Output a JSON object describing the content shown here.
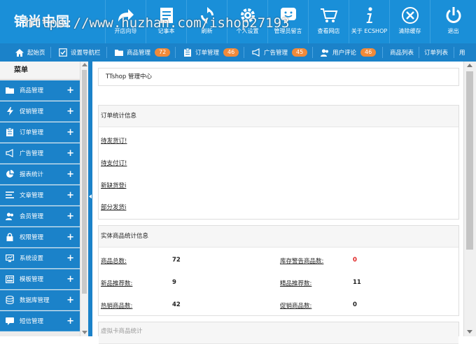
{
  "header": {
    "logo": "锦尚中国",
    "watermark": "https://www.huzhan.com/ishop27193",
    "buttons": [
      {
        "icon": "share-arrow-icon",
        "label": "开店向导"
      },
      {
        "icon": "notepad-icon",
        "label": "记事本"
      },
      {
        "icon": "refresh-icon",
        "label": "刷新"
      },
      {
        "icon": "gear-icon",
        "label": "个人设置"
      },
      {
        "icon": "chat-smile-icon",
        "label": "管理员留言"
      },
      {
        "icon": "cart-icon",
        "label": "查看网店"
      },
      {
        "icon": "info-icon",
        "label": "关于 ECSHOP"
      },
      {
        "icon": "close-circle-icon",
        "label": "清除缓存"
      },
      {
        "icon": "power-icon",
        "label": "退出"
      }
    ]
  },
  "nav": {
    "items": [
      {
        "icon": "home-icon",
        "label": "起始页"
      },
      {
        "icon": "check-box-icon",
        "label": "设置导航栏"
      },
      {
        "icon": "folder-icon",
        "label": "商品管理",
        "badge": "72"
      },
      {
        "icon": "clipboard-icon",
        "label": "订单管理",
        "badge": "46"
      },
      {
        "icon": "megaphone-icon",
        "label": "广告管理",
        "badge": "45"
      },
      {
        "icon": "users-icon",
        "label": "用户评论",
        "badge": "46"
      },
      {
        "label": "商品列表"
      },
      {
        "label": "订单列表"
      },
      {
        "label": "用"
      }
    ]
  },
  "sidebar": {
    "title": "菜单",
    "items": [
      {
        "icon": "folder-icon",
        "label": "商品管理"
      },
      {
        "icon": "lightning-icon",
        "label": "促销管理"
      },
      {
        "icon": "clipboard-icon",
        "label": "订单管理"
      },
      {
        "icon": "megaphone-icon",
        "label": "广告管理"
      },
      {
        "icon": "pie-chart-icon",
        "label": "报表统计"
      },
      {
        "icon": "list-icon",
        "label": "文章管理"
      },
      {
        "icon": "users-icon",
        "label": "会员管理"
      },
      {
        "icon": "lock-icon",
        "label": "权限管理"
      },
      {
        "icon": "monitor-icon",
        "label": "系统设置"
      },
      {
        "icon": "template-icon",
        "label": "模板管理"
      },
      {
        "icon": "database-icon",
        "label": "数据库管理"
      },
      {
        "icon": "message-icon",
        "label": "短信管理"
      }
    ],
    "plus": "+"
  },
  "main": {
    "breadcrumb": "TTshop 管理中心",
    "order_panel": {
      "title": "订单统计信息",
      "rows": [
        "待发货订!",
        "待支付订!",
        "新缺货登i",
        "部分发货i"
      ]
    },
    "goods_panel": {
      "title": "实体商品统计信息",
      "rows": [
        {
          "label": "商品总数:",
          "value": "72",
          "label2": "库存警告商品数:",
          "value2": "0"
        },
        {
          "label": "新品推荐数:",
          "value": "9",
          "label2": "精品推荐数:",
          "value2": "11"
        },
        {
          "label": "热销商品数:",
          "value": "42",
          "label2": "促销商品数:",
          "value2": "0"
        }
      ]
    },
    "next_panel_title": "虚拟卡商品统计"
  }
}
